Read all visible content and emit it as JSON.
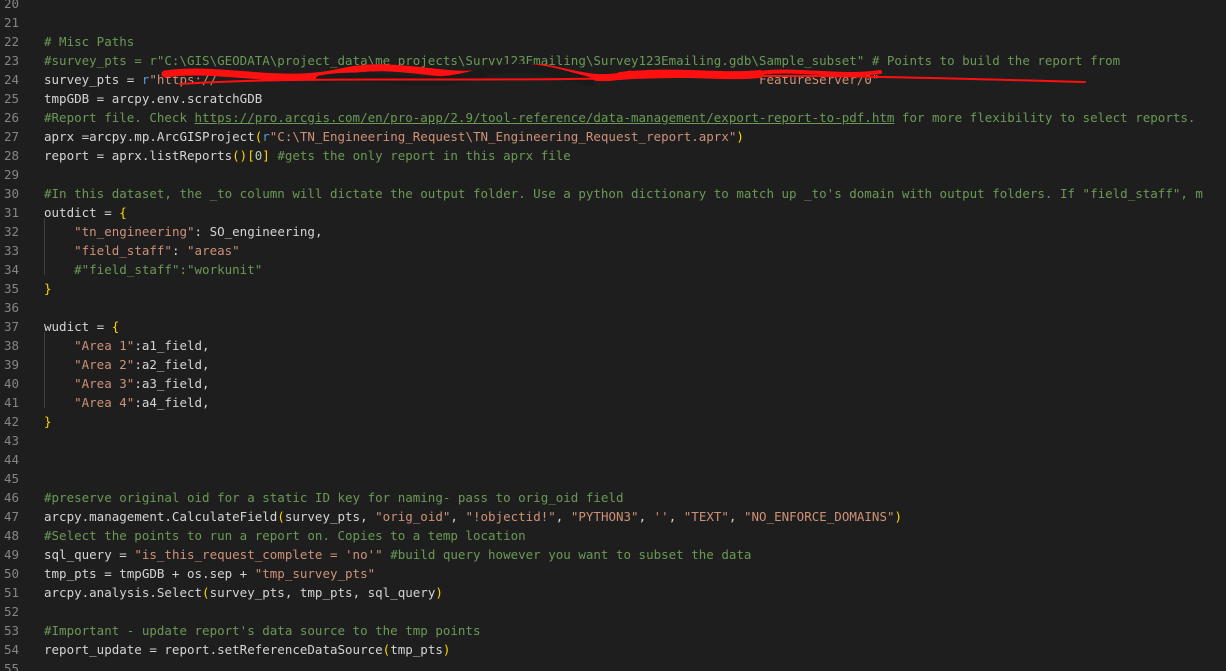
{
  "editor": {
    "lines": [
      {
        "n": "20",
        "segs": []
      },
      {
        "n": "21",
        "segs": []
      },
      {
        "n": "22",
        "segs": [
          {
            "t": "# Misc Paths",
            "c": "cm"
          }
        ]
      },
      {
        "n": "23",
        "segs": [
          {
            "t": "#survey_pts = r\"C:\\GIS\\GEODATA\\project_data\\me_projects\\Survy123Emailing\\Survey123Emailing.gdb\\Sample_subset\" # Points to build the report from",
            "c": "cm"
          }
        ]
      },
      {
        "n": "24",
        "segs": [
          {
            "t": "survey_pts = ",
            "c": ""
          },
          {
            "t": "r",
            "c": "kw"
          },
          {
            "t": "\"https://",
            "c": "st"
          },
          {
            "t": "                                                                        ",
            "c": "st"
          },
          {
            "t": "FeatureServer/0\"",
            "c": "st"
          }
        ]
      },
      {
        "n": "25",
        "segs": [
          {
            "t": "tmpGDB = arcpy.env.scratchGDB",
            "c": ""
          }
        ]
      },
      {
        "n": "26",
        "segs": [
          {
            "t": "#Report file. Check ",
            "c": "cm"
          },
          {
            "t": "https://pro.arcgis.com/en/pro-app/2.9/tool-reference/data-management/export-report-to-pdf.htm",
            "c": "cm lnk"
          },
          {
            "t": " for more flexibility to select reports.",
            "c": "cm"
          }
        ]
      },
      {
        "n": "27",
        "segs": [
          {
            "t": "aprx =arcpy.mp.ArcGISProject",
            "c": ""
          },
          {
            "t": "(",
            "c": "b1"
          },
          {
            "t": "r",
            "c": "kw"
          },
          {
            "t": "\"C:\\TN_Engineering_Request\\TN_Engineering_Request_report.aprx\"",
            "c": "st"
          },
          {
            "t": ")",
            "c": "b1"
          }
        ]
      },
      {
        "n": "28",
        "segs": [
          {
            "t": "report = aprx.listReports",
            "c": ""
          },
          {
            "t": "()",
            "c": "b1"
          },
          {
            "t": "[",
            "c": "b1"
          },
          {
            "t": "0",
            "c": "nu"
          },
          {
            "t": "]",
            "c": "b1"
          },
          {
            "t": " #gets the only report in this aprx file",
            "c": "cm"
          }
        ]
      },
      {
        "n": "29",
        "segs": []
      },
      {
        "n": "30",
        "segs": [
          {
            "t": "#In this dataset, the _to column will dictate the output folder. Use a python dictionary to match up _to's domain with output folders. If \"field_staff\", m",
            "c": "cm"
          }
        ]
      },
      {
        "n": "31",
        "segs": [
          {
            "t": "outdict = ",
            "c": ""
          },
          {
            "t": "{",
            "c": "b1"
          }
        ]
      },
      {
        "n": "32",
        "segs": [
          {
            "t": "    ",
            "c": ""
          },
          {
            "t": "\"tn_engineering\"",
            "c": "st"
          },
          {
            "t": ": SO_engineering,",
            "c": ""
          }
        ]
      },
      {
        "n": "33",
        "segs": [
          {
            "t": "    ",
            "c": ""
          },
          {
            "t": "\"field_staff\"",
            "c": "st"
          },
          {
            "t": ": ",
            "c": ""
          },
          {
            "t": "\"areas\"",
            "c": "st"
          }
        ]
      },
      {
        "n": "34",
        "segs": [
          {
            "t": "    ",
            "c": ""
          },
          {
            "t": "#\"field_staff\":\"workunit\"",
            "c": "cm"
          }
        ]
      },
      {
        "n": "35",
        "segs": [
          {
            "t": "}",
            "c": "b1"
          }
        ]
      },
      {
        "n": "36",
        "segs": []
      },
      {
        "n": "37",
        "segs": [
          {
            "t": "wudict = ",
            "c": ""
          },
          {
            "t": "{",
            "c": "b1"
          }
        ]
      },
      {
        "n": "38",
        "segs": [
          {
            "t": "    ",
            "c": ""
          },
          {
            "t": "\"Area 1\"",
            "c": "st"
          },
          {
            "t": ":a1_field,",
            "c": ""
          }
        ]
      },
      {
        "n": "39",
        "segs": [
          {
            "t": "    ",
            "c": ""
          },
          {
            "t": "\"Area 2\"",
            "c": "st"
          },
          {
            "t": ":a2_field,",
            "c": ""
          }
        ]
      },
      {
        "n": "40",
        "segs": [
          {
            "t": "    ",
            "c": ""
          },
          {
            "t": "\"Area 3\"",
            "c": "st"
          },
          {
            "t": ":a3_field,",
            "c": ""
          }
        ]
      },
      {
        "n": "41",
        "segs": [
          {
            "t": "    ",
            "c": ""
          },
          {
            "t": "\"Area 4\"",
            "c": "st"
          },
          {
            "t": ":a4_field,",
            "c": ""
          }
        ]
      },
      {
        "n": "42",
        "segs": [
          {
            "t": "}",
            "c": "b1"
          }
        ]
      },
      {
        "n": "43",
        "segs": []
      },
      {
        "n": "44",
        "segs": []
      },
      {
        "n": "45",
        "segs": []
      },
      {
        "n": "46",
        "segs": [
          {
            "t": "#preserve original oid for a static ID key for naming- pass to orig_oid field",
            "c": "cm"
          }
        ]
      },
      {
        "n": "47",
        "segs": [
          {
            "t": "arcpy.management.CalculateField",
            "c": ""
          },
          {
            "t": "(",
            "c": "b1"
          },
          {
            "t": "survey_pts, ",
            "c": ""
          },
          {
            "t": "\"orig_oid\"",
            "c": "st"
          },
          {
            "t": ", ",
            "c": ""
          },
          {
            "t": "\"!objectid!\"",
            "c": "st"
          },
          {
            "t": ", ",
            "c": ""
          },
          {
            "t": "\"PYTHON3\"",
            "c": "st"
          },
          {
            "t": ", ",
            "c": ""
          },
          {
            "t": "''",
            "c": "st"
          },
          {
            "t": ", ",
            "c": ""
          },
          {
            "t": "\"TEXT\"",
            "c": "st"
          },
          {
            "t": ", ",
            "c": ""
          },
          {
            "t": "\"NO_ENFORCE_DOMAINS\"",
            "c": "st"
          },
          {
            "t": ")",
            "c": "b1"
          }
        ]
      },
      {
        "n": "48",
        "segs": [
          {
            "t": "#Select the points to run a report on. Copies to a temp location",
            "c": "cm"
          }
        ]
      },
      {
        "n": "49",
        "segs": [
          {
            "t": "sql_query = ",
            "c": ""
          },
          {
            "t": "\"is_this_request_complete = 'no'\"",
            "c": "st"
          },
          {
            "t": " #build query however you want to subset the data",
            "c": "cm"
          }
        ]
      },
      {
        "n": "50",
        "segs": [
          {
            "t": "tmp_pts = tmpGDB + os.sep + ",
            "c": ""
          },
          {
            "t": "\"tmp_survey_pts\"",
            "c": "st"
          }
        ]
      },
      {
        "n": "51",
        "segs": [
          {
            "t": "arcpy.analysis.Select",
            "c": ""
          },
          {
            "t": "(",
            "c": "b1"
          },
          {
            "t": "survey_pts, tmp_pts, sql_query",
            "c": ""
          },
          {
            "t": ")",
            "c": "b1"
          }
        ]
      },
      {
        "n": "52",
        "segs": []
      },
      {
        "n": "53",
        "segs": [
          {
            "t": "#Important - update report's data source to the tmp points",
            "c": "cm"
          }
        ]
      },
      {
        "n": "54",
        "segs": [
          {
            "t": "report_update = report.setReferenceDataSource",
            "c": ""
          },
          {
            "t": "(",
            "c": "b1"
          },
          {
            "t": "tmp_pts",
            "c": ""
          },
          {
            "t": ")",
            "c": "b1"
          }
        ]
      },
      {
        "n": "55",
        "segs": []
      }
    ]
  },
  "colors": {
    "background": "#1e1e1e",
    "line_number": "#858585",
    "comment": "#6a9955",
    "string": "#ce9178",
    "keyword": "#569cd6",
    "number": "#b5cea8",
    "bracket": "#ffd700",
    "redaction": "#ff1010"
  }
}
